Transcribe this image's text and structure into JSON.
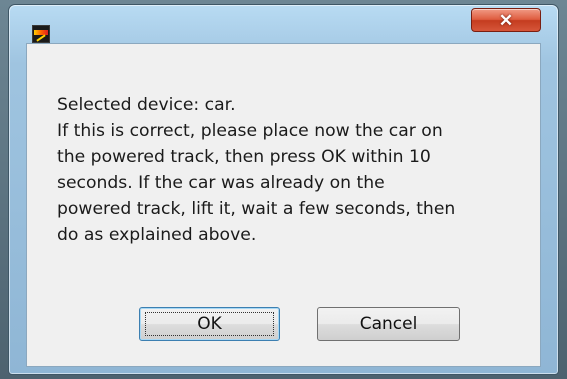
{
  "window": {
    "title": "",
    "close_glyph": "✕"
  },
  "dialog": {
    "message_lines": [
      "Selected device: car.",
      "If this is correct, please place now the car on",
      "the powered track, then press OK within 10",
      "seconds. If the car was already on the",
      "powered track, lift it, wait a few seconds, then",
      "do as explained above."
    ]
  },
  "buttons": {
    "ok_label": "OK",
    "cancel_label": "Cancel"
  },
  "icons": {
    "app": "app-icon",
    "close": "close-icon"
  },
  "colors": {
    "client_background": "#f0f0f0",
    "close_button": "#c43c1f",
    "frame": "#9fc4e0",
    "focus_border": "#3c7fb1"
  }
}
